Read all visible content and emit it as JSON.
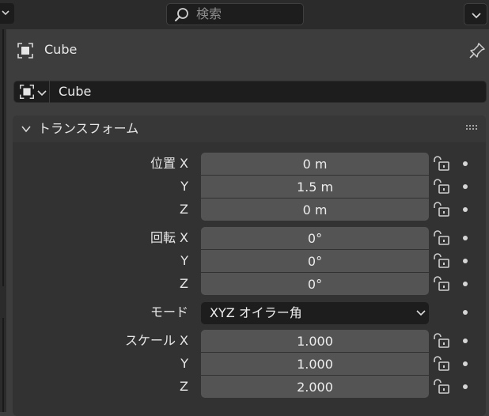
{
  "header": {
    "search_placeholder": "検索"
  },
  "context": {
    "object_name": "Cube"
  },
  "name_field": {
    "value": "Cube"
  },
  "panel": {
    "title": "トランスフォーム",
    "location": {
      "label": "位置 X",
      "rows": [
        {
          "axis_label": "位置 X",
          "value": "0 m"
        },
        {
          "axis_label": "Y",
          "value": "1.5 m"
        },
        {
          "axis_label": "Z",
          "value": "0 m"
        }
      ]
    },
    "rotation": {
      "rows": [
        {
          "axis_label": "回転 X",
          "value": "0°"
        },
        {
          "axis_label": "Y",
          "value": "0°"
        },
        {
          "axis_label": "Z",
          "value": "0°"
        }
      ]
    },
    "mode": {
      "label": "モード",
      "value": "XYZ オイラー角"
    },
    "scale": {
      "rows": [
        {
          "axis_label": "スケール X",
          "value": "1.000"
        },
        {
          "axis_label": "Y",
          "value": "1.000"
        },
        {
          "axis_label": "Z",
          "value": "2.000"
        }
      ]
    }
  },
  "icons": {
    "editor_type": "properties-editor-icon",
    "search": "search-icon",
    "object": "object-data-icon",
    "pin": "pin-icon",
    "lock": "unlocked-padlock-icon",
    "keyframe": "animate-dot-icon"
  }
}
